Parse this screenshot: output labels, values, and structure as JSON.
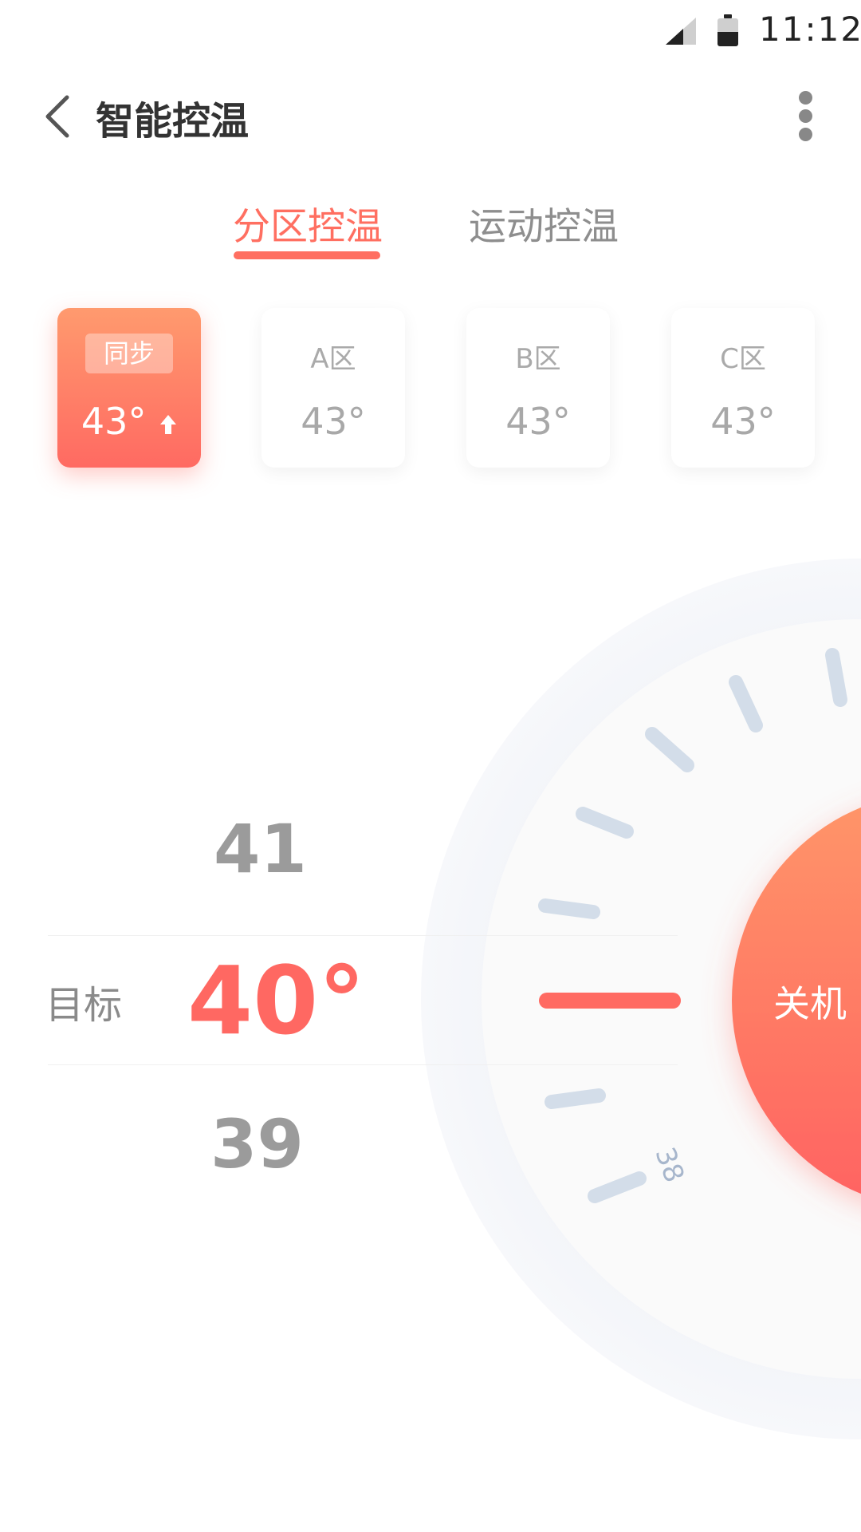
{
  "status_bar": {
    "time": "11:12",
    "battery_icon": "battery-icon",
    "signal_icon": "signal-icon"
  },
  "header": {
    "title": "智能控温",
    "back_icon": "chevron-left-icon",
    "more_icon": "more-vertical-icon"
  },
  "tabs": [
    {
      "label": "分区控温",
      "active": true
    },
    {
      "label": "运动控温",
      "active": false
    }
  ],
  "zones": [
    {
      "label": "同步",
      "temp": "43°",
      "trend_icon": "arrow-up-icon",
      "selected": true
    },
    {
      "label": "A区",
      "temp": "43°",
      "selected": false
    },
    {
      "label": "B区",
      "temp": "43°",
      "selected": false
    },
    {
      "label": "C区",
      "temp": "43°",
      "selected": false
    }
  ],
  "picker": {
    "above": "41",
    "target_label": "目标",
    "target_value": "40°",
    "below": "39"
  },
  "dial": {
    "scale_label": "38",
    "power_button_label": "关机"
  },
  "colors": {
    "accent": "#ff6f61",
    "gradient_start": "#ff9a6e",
    "gradient_end": "#ff6862",
    "tick": "#d3dde9",
    "ring": "#f3f5f9"
  }
}
